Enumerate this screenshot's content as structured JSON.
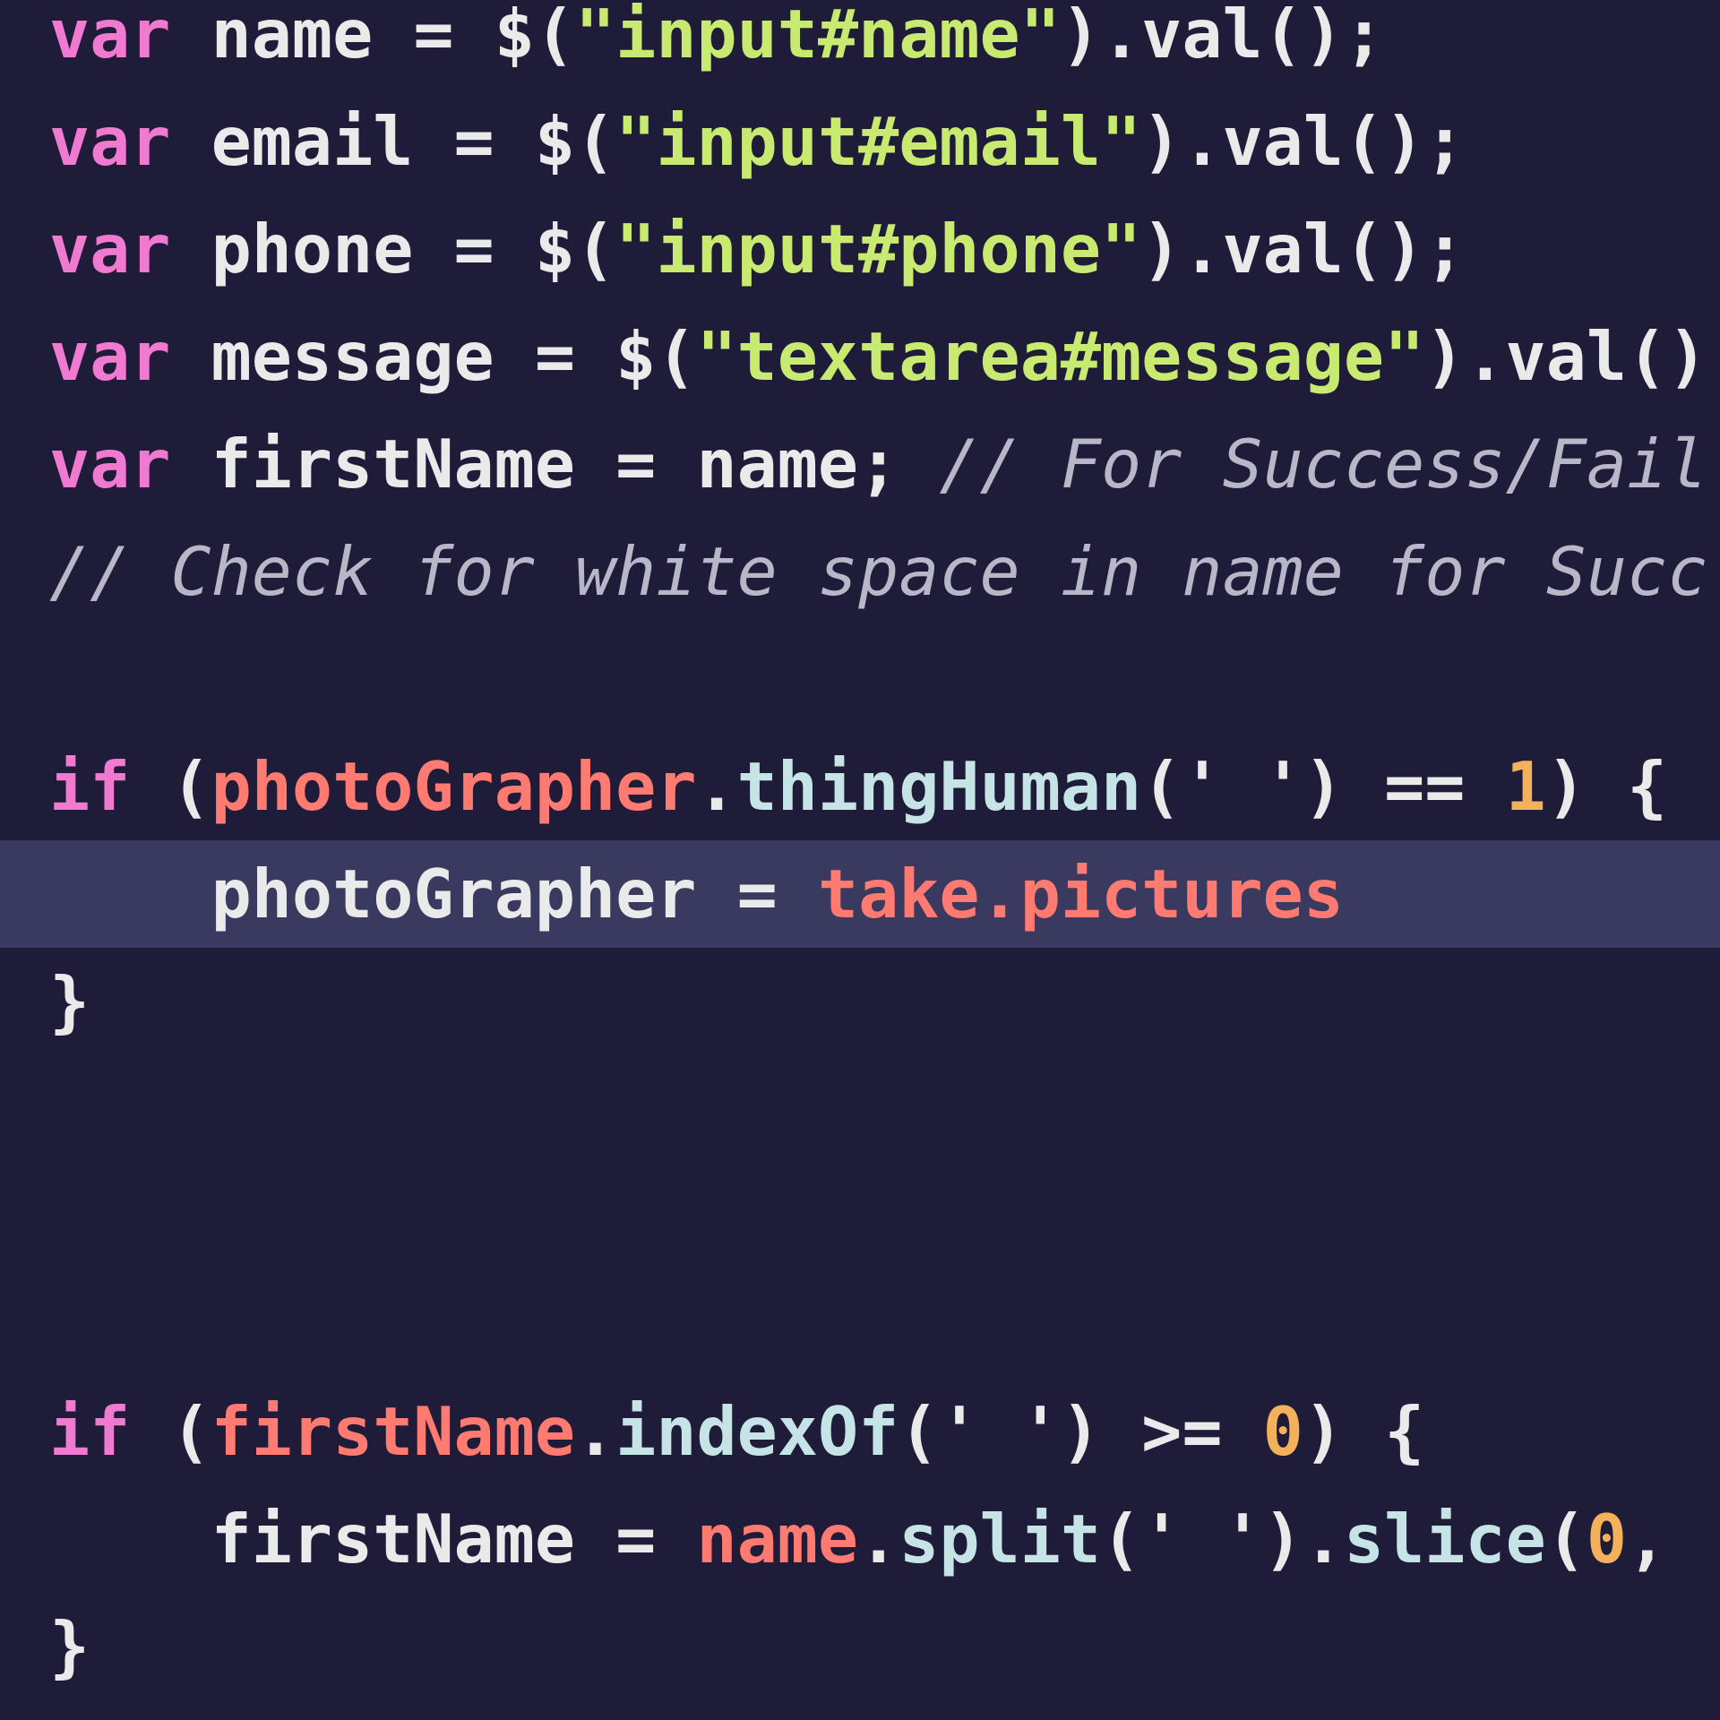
{
  "editor": {
    "lines": [
      {
        "tokens": [
          {
            "t": "var",
            "c": "kw"
          },
          {
            "t": " name = $(",
            "c": "id"
          },
          {
            "t": "\"input#name\"",
            "c": "str"
          },
          {
            "t": ").val();",
            "c": "id"
          }
        ]
      },
      {
        "tokens": [
          {
            "t": "var",
            "c": "kw"
          },
          {
            "t": " email = $(",
            "c": "id"
          },
          {
            "t": "\"input#email\"",
            "c": "str"
          },
          {
            "t": ").val();",
            "c": "id"
          }
        ]
      },
      {
        "tokens": [
          {
            "t": "var",
            "c": "kw"
          },
          {
            "t": " phone = $(",
            "c": "id"
          },
          {
            "t": "\"input#phone\"",
            "c": "str"
          },
          {
            "t": ").val();",
            "c": "id"
          }
        ]
      },
      {
        "tokens": [
          {
            "t": "var",
            "c": "kw"
          },
          {
            "t": " message = $(",
            "c": "id"
          },
          {
            "t": "\"textarea#message\"",
            "c": "str"
          },
          {
            "t": ").val()",
            "c": "id"
          }
        ]
      },
      {
        "tokens": [
          {
            "t": "var",
            "c": "kw"
          },
          {
            "t": " firstName = name; ",
            "c": "id"
          },
          {
            "t": "// For Success/Fail",
            "c": "cmt"
          }
        ]
      },
      {
        "tokens": [
          {
            "t": "// Check for white space in name for Succ",
            "c": "cmt"
          }
        ]
      },
      {
        "tokens": []
      },
      {
        "tokens": [
          {
            "t": "if",
            "c": "kw"
          },
          {
            "t": " (",
            "c": "id"
          },
          {
            "t": "photoGrapher",
            "c": "obj"
          },
          {
            "t": ".",
            "c": "id"
          },
          {
            "t": "thingHuman",
            "c": "fn"
          },
          {
            "t": "(' ') == ",
            "c": "id"
          },
          {
            "t": "1",
            "c": "num"
          },
          {
            "t": ") {",
            "c": "id"
          }
        ]
      },
      {
        "highlighted": true,
        "tokens": [
          {
            "t": "    photoGrapher = ",
            "c": "id"
          },
          {
            "t": "take.pictures",
            "c": "obj"
          }
        ]
      },
      {
        "tokens": [
          {
            "t": "}",
            "c": "id"
          }
        ]
      },
      {
        "tokens": []
      },
      {
        "tokens": []
      },
      {
        "tokens": []
      },
      {
        "tokens": [
          {
            "t": "if",
            "c": "kw"
          },
          {
            "t": " (",
            "c": "id"
          },
          {
            "t": "firstName",
            "c": "obj"
          },
          {
            "t": ".",
            "c": "id"
          },
          {
            "t": "indexOf",
            "c": "fn"
          },
          {
            "t": "(' ') >= ",
            "c": "id"
          },
          {
            "t": "0",
            "c": "num"
          },
          {
            "t": ") {",
            "c": "id"
          }
        ]
      },
      {
        "tokens": [
          {
            "t": "    firstName = ",
            "c": "id"
          },
          {
            "t": "name",
            "c": "obj"
          },
          {
            "t": ".",
            "c": "id"
          },
          {
            "t": "split",
            "c": "fn"
          },
          {
            "t": "(' ').",
            "c": "id"
          },
          {
            "t": "slice",
            "c": "fn"
          },
          {
            "t": "(",
            "c": "id"
          },
          {
            "t": "0",
            "c": "num"
          },
          {
            "t": ",",
            "c": "id"
          }
        ]
      },
      {
        "tokens": [
          {
            "t": "}",
            "c": "id"
          }
        ]
      }
    ]
  }
}
